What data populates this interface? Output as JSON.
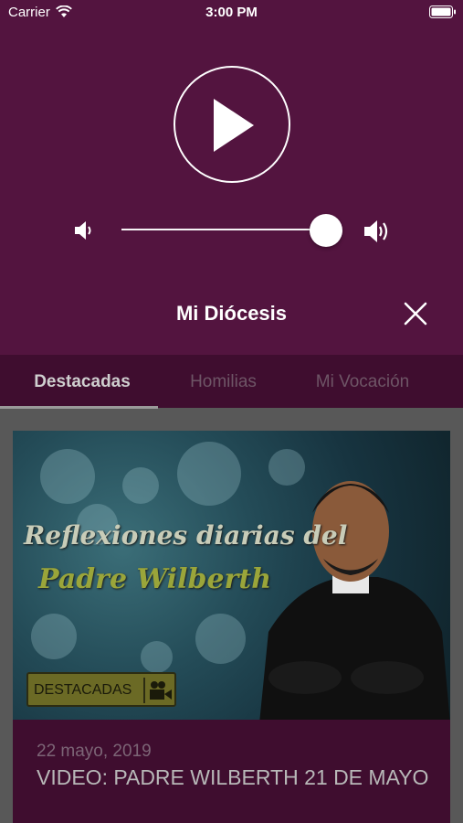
{
  "status_bar": {
    "carrier": "Carrier",
    "time": "3:00 PM"
  },
  "player": {
    "state": "paused",
    "volume_level": 0.88
  },
  "station": {
    "title": "Mi Diócesis"
  },
  "tabs": [
    {
      "label": "Destacadas",
      "active": true
    },
    {
      "label": "Homilias",
      "active": false
    },
    {
      "label": "Mi Vocación",
      "active": false
    }
  ],
  "card": {
    "thumbnail_text_line1": "Reflexiones diarias del",
    "thumbnail_text_line2": "Padre Wilberth",
    "badge": "DESTACADAS",
    "date": "22 mayo, 2019",
    "title": "VIDEO: PADRE WILBERTH 21 DE MAYO"
  },
  "colors": {
    "player_bg": "#53143f",
    "tabs_bg": "#3f0d2f",
    "badge_bg": "#6b6a25"
  }
}
